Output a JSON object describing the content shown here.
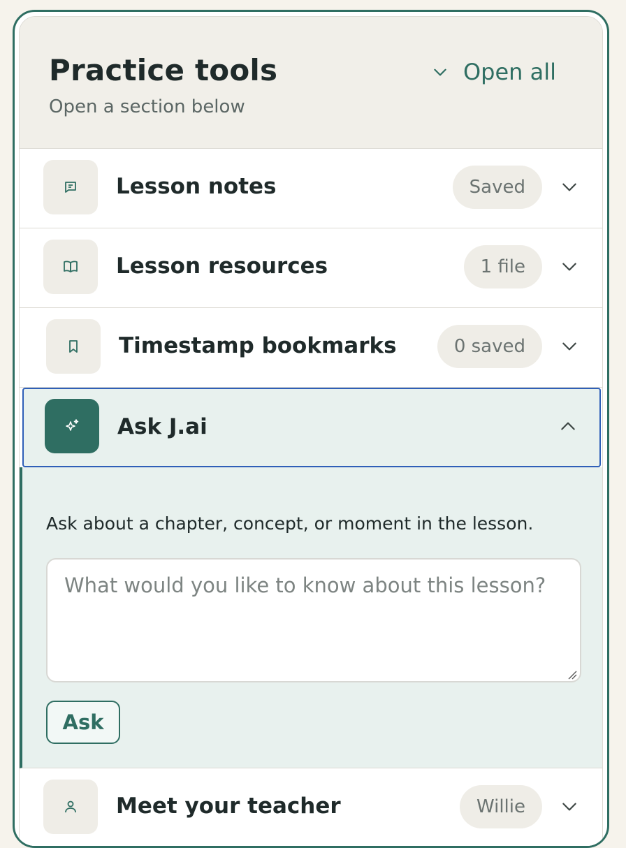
{
  "panel": {
    "title": "Practice tools",
    "subtitle": "Open a section below",
    "open_all_label": "Open all"
  },
  "sections": [
    {
      "title": "Lesson notes",
      "badge": "Saved",
      "icon": "note-icon"
    },
    {
      "title": "Lesson resources",
      "badge": "1 file",
      "icon": "book-icon"
    },
    {
      "title": "Timestamp bookmarks",
      "badge": "0 saved",
      "icon": "bookmark-icon"
    },
    {
      "title": "Ask J.ai",
      "badge": "",
      "icon": "sparkle-icon",
      "expanded": true
    },
    {
      "title": "Meet your teacher",
      "badge": "Willie",
      "icon": "person-icon"
    }
  ],
  "ask": {
    "description": "Ask about a chapter, concept, or moment in the lesson.",
    "placeholder": "What would you like to know about this lesson?",
    "value": "",
    "button_label": "Ask"
  },
  "colors": {
    "accent": "#2f6e62",
    "active_border": "#2f5fb8",
    "expanded_bg": "#e8f1ee",
    "page_bg": "#f6f3ec"
  }
}
